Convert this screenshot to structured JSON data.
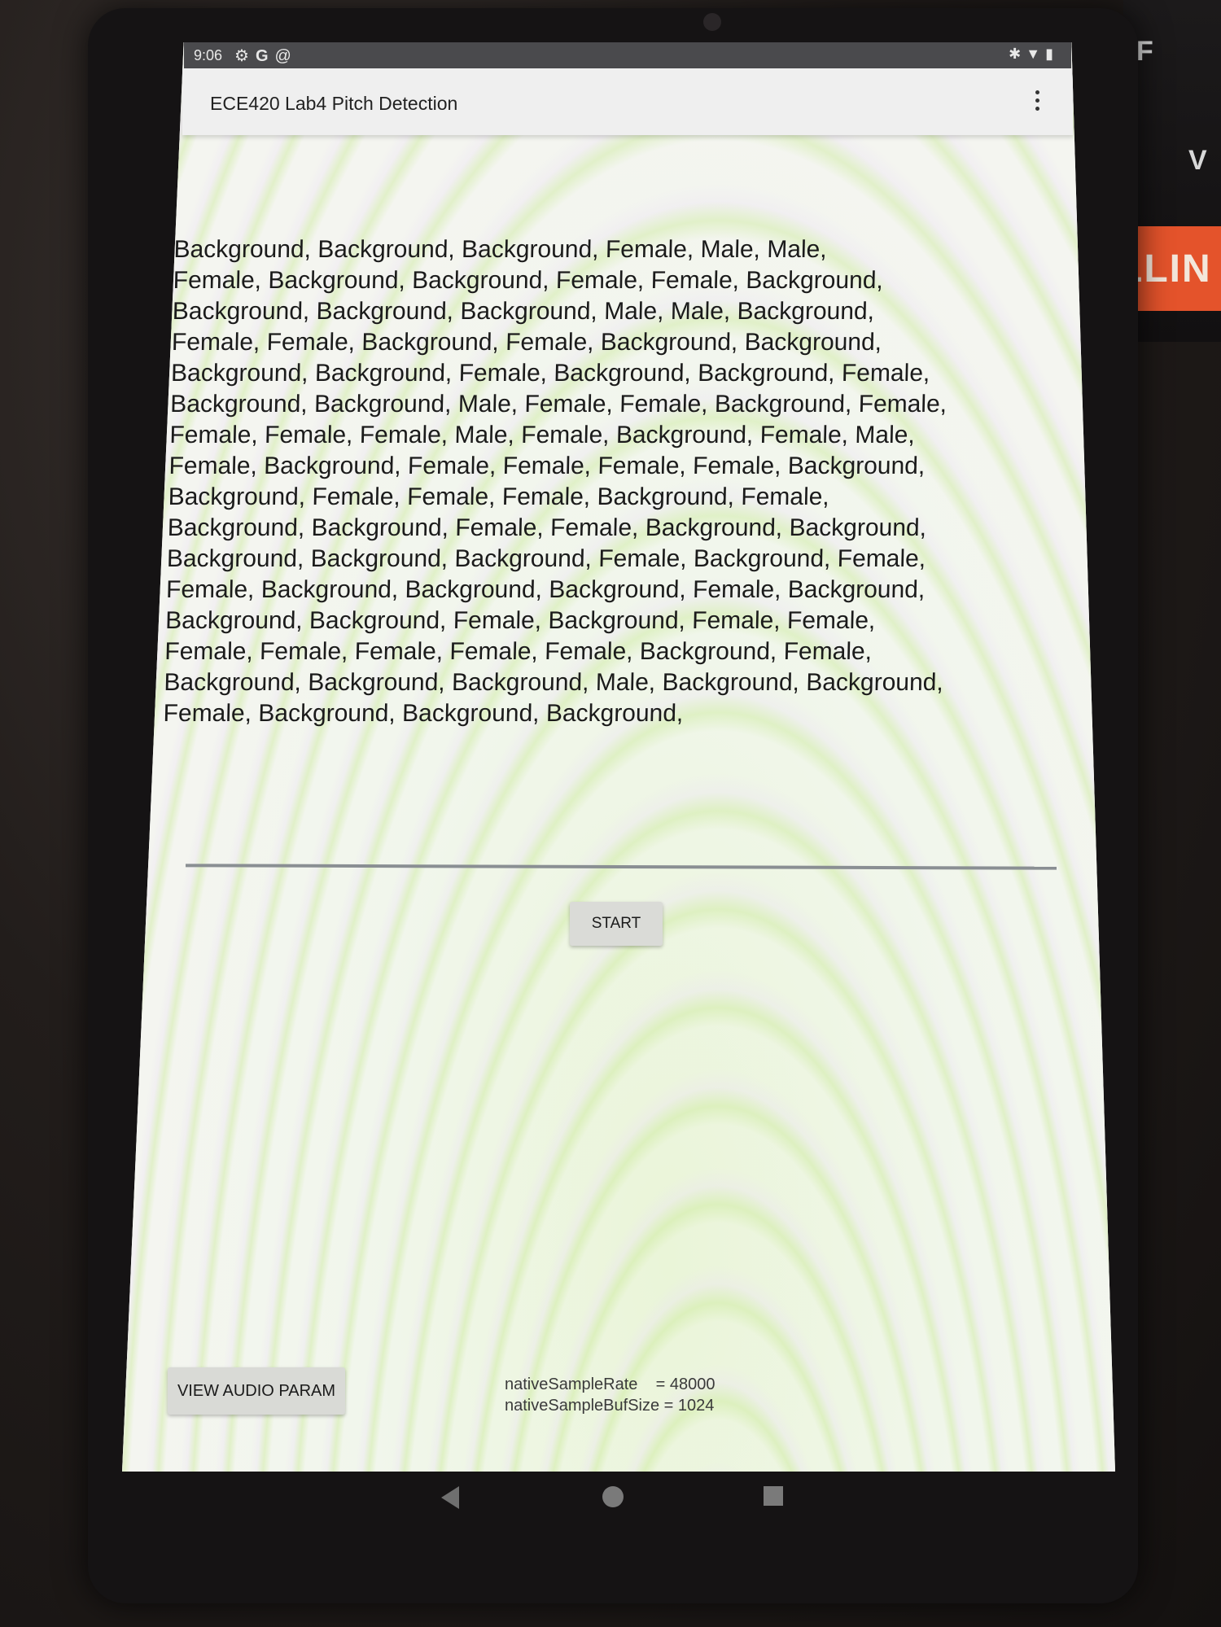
{
  "status_bar": {
    "time": "9:06",
    "left_icons": [
      "gear-icon",
      "google-icon",
      "at-sign-icon"
    ],
    "right_icons": [
      "bluetooth-icon",
      "wifi-icon",
      "battery-icon"
    ]
  },
  "app_bar": {
    "title": "ECE420 Lab4 Pitch Detection"
  },
  "results": {
    "lines": [
      "Background, Background, Background, Female, Male, Male,",
      "Female, Background, Background, Female, Female, Background,",
      "Background, Background, Background, Male, Male, Background,",
      "Female, Female, Background, Female, Background, Background,",
      "Background, Background, Female, Background, Background, Female,",
      "Background, Background, Male, Female, Female, Background, Female,",
      "Female, Female, Female, Male, Female, Background, Female, Male,",
      "Female, Background, Female, Female, Female, Female, Background,",
      "Background, Female, Female, Female, Background, Female,",
      "Background, Background, Female, Female, Background, Background,",
      "Background, Background, Background, Female, Background, Female,",
      "Female, Background, Background, Background, Female, Background,",
      "Background, Background, Female, Background, Female, Female,",
      "Female, Female, Female, Female, Female, Background, Female,",
      "Background, Background, Background, Male, Background, Background,",
      "Female, Background, Background, Background,"
    ]
  },
  "controls": {
    "start_label": "START",
    "view_audio_label": "VIEW AUDIO PARAM"
  },
  "audio_params": {
    "text": "nativeSampleRate    = 48000\nnativeSampleBufSize = 1024"
  },
  "surroundings": {
    "keyboard_keys": [
      "F",
      "V"
    ],
    "sticker_text": "LLIN",
    "sticker_color": "#e4532b"
  }
}
